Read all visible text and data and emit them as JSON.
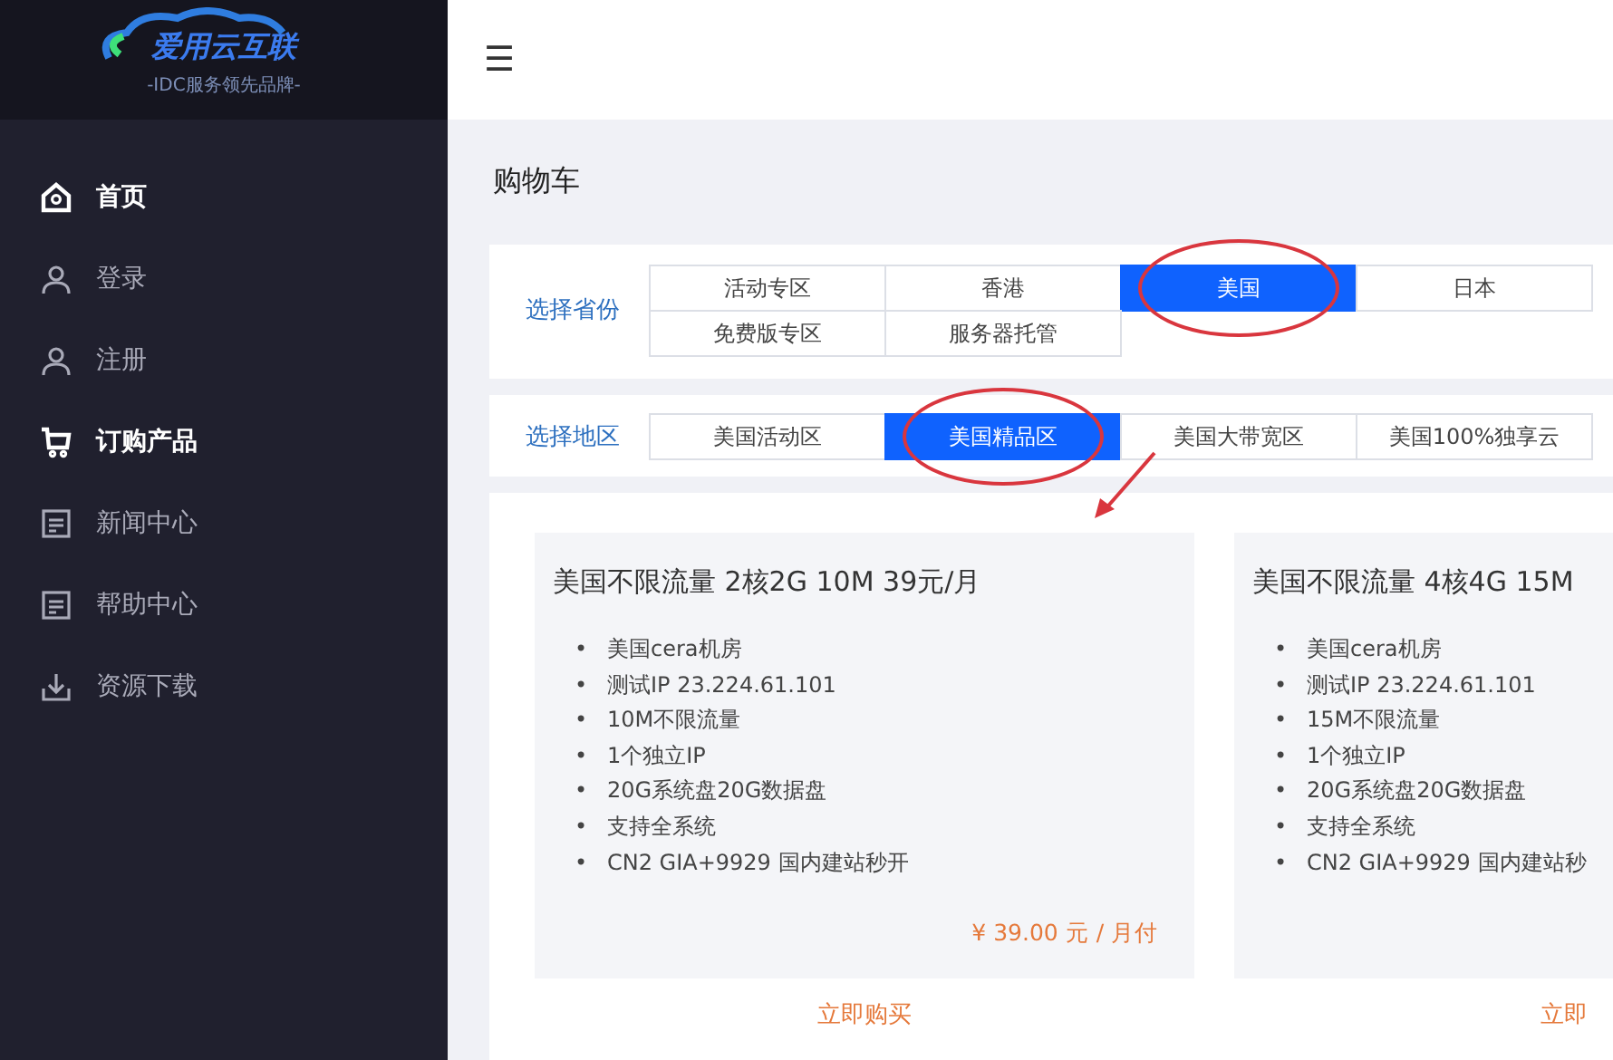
{
  "logo": {
    "name": "爱用云互联",
    "slogan": "-IDC服务领先品牌-"
  },
  "sidebar": {
    "items": [
      {
        "label": "首页",
        "kind": "home",
        "active": true
      },
      {
        "label": "登录",
        "kind": "user",
        "active": false
      },
      {
        "label": "注册",
        "kind": "user",
        "active": false
      },
      {
        "label": "订购产品",
        "kind": "cart",
        "active": true
      },
      {
        "label": "新闻中心",
        "kind": "doc",
        "active": false
      },
      {
        "label": "帮助中心",
        "kind": "doc",
        "active": false
      },
      {
        "label": "资源下载",
        "kind": "download",
        "active": false
      }
    ]
  },
  "topbar": {
    "menu": "☰"
  },
  "page_title": "购物车",
  "filters": [
    {
      "label": "选择省份",
      "options": [
        {
          "label": "活动专区",
          "selected": false,
          "circled": false
        },
        {
          "label": "香港",
          "selected": false,
          "circled": false
        },
        {
          "label": "美国",
          "selected": true,
          "circled": true
        },
        {
          "label": "日本",
          "selected": false,
          "circled": false
        },
        {
          "label": "免费版专区",
          "selected": false,
          "circled": false
        },
        {
          "label": "服务器托管",
          "selected": false,
          "circled": false
        }
      ]
    },
    {
      "label": "选择地区",
      "options": [
        {
          "label": "美国活动区",
          "selected": false,
          "circled": false
        },
        {
          "label": "美国精品区",
          "selected": true,
          "circled": true
        },
        {
          "label": "美国大带宽区",
          "selected": false,
          "circled": false
        },
        {
          "label": "美国100%独享云",
          "selected": false,
          "circled": false
        }
      ]
    }
  ],
  "products": [
    {
      "title": "美国不限流量 2核2G 10M 39元/月",
      "bullet": "•",
      "features": [
        "美国cera机房",
        "测试IP 23.224.61.101",
        "10M不限流量",
        "1个独立IP",
        "20G系统盘20G数据盘",
        "支持全系统",
        "CN2 GIA+9929 国内建站秒开"
      ],
      "price": "¥ 39.00 元 / 月付",
      "button": "立即购买"
    },
    {
      "title": "美国不限流量 4核4G 15M",
      "bullet": "•",
      "features": [
        "美国cera机房",
        "测试IP 23.224.61.101",
        "15M不限流量",
        "1个独立IP",
        "20G系统盘20G数据盘",
        "支持全系统",
        "CN2 GIA+9929 国内建站秒"
      ],
      "button": "立即"
    }
  ]
}
